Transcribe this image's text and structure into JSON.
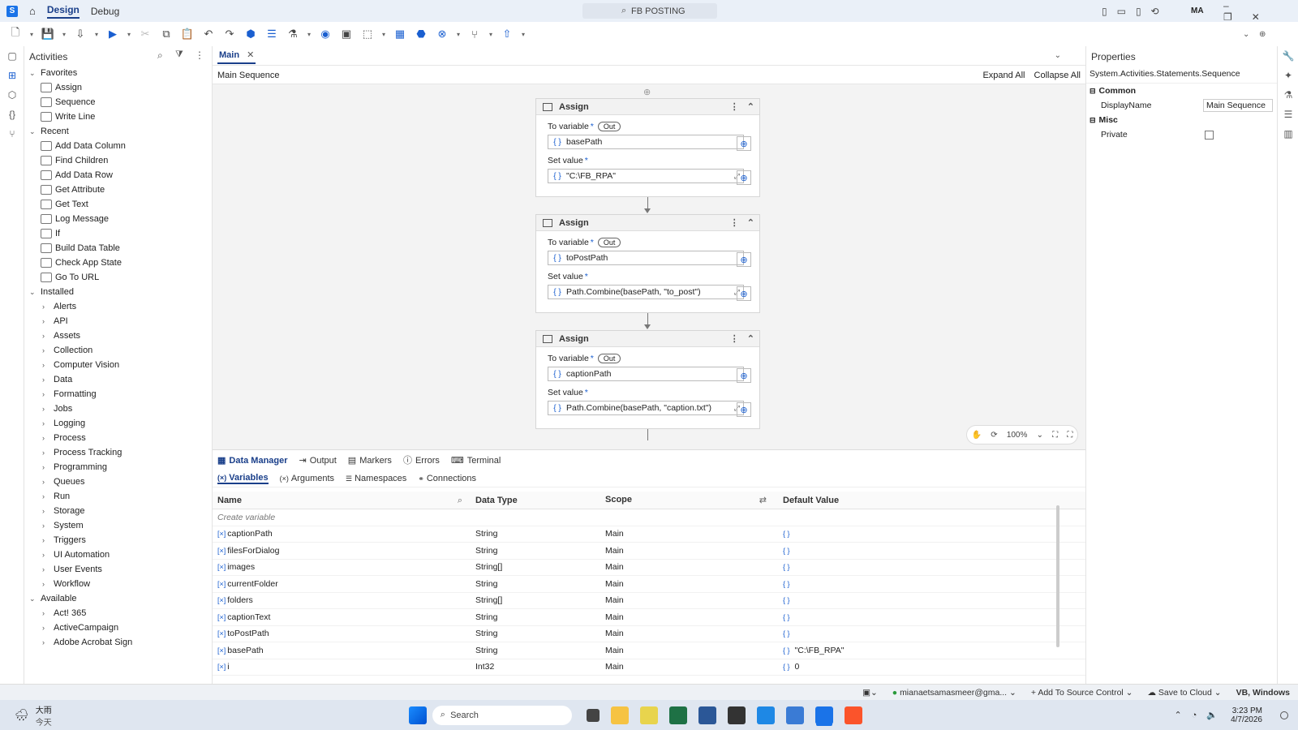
{
  "titlebar": {
    "tabs": [
      "Design",
      "Debug"
    ],
    "search": "FB POSTING",
    "user": "MA"
  },
  "activities": {
    "title": "Activities",
    "favorites_label": "Favorites",
    "favorites": [
      "Assign",
      "Sequence",
      "Write Line"
    ],
    "recent_label": "Recent",
    "recent": [
      "Add Data Column",
      "Find Children",
      "Add Data Row",
      "Get Attribute",
      "Get Text",
      "Log Message",
      "If",
      "Build Data Table",
      "Check App State",
      "Go To URL"
    ],
    "installed_label": "Installed",
    "installed": [
      "Alerts",
      "API",
      "Assets",
      "Collection",
      "Computer Vision",
      "Data",
      "Formatting",
      "Jobs",
      "Logging",
      "Process",
      "Process Tracking",
      "Programming",
      "Queues",
      "Run",
      "Storage",
      "System",
      "Triggers",
      "UI Automation",
      "User Events",
      "Workflow"
    ],
    "available_label": "Available",
    "available": [
      "Act! 365",
      "ActiveCampaign",
      "Adobe Acrobat Sign"
    ]
  },
  "designer": {
    "tab": "Main",
    "breadcrumb": "Main Sequence",
    "expand_all": "Expand All",
    "collapse_all": "Collapse All",
    "zoom": "100%",
    "assigns": [
      {
        "title": "Assign",
        "to_label": "To variable",
        "out": "Out",
        "to_value": "basePath",
        "set_label": "Set value",
        "set_value": "\"C:\\FB_RPA\""
      },
      {
        "title": "Assign",
        "to_label": "To variable",
        "out": "Out",
        "to_value": "toPostPath",
        "set_label": "Set value",
        "set_value": "Path.Combine(basePath, \"to_post\")"
      },
      {
        "title": "Assign",
        "to_label": "To variable",
        "out": "Out",
        "to_value": "captionPath",
        "set_label": "Set value",
        "set_value": "Path.Combine(basePath, \"caption.txt\")"
      }
    ]
  },
  "datapanel": {
    "tabs": [
      "Data Manager",
      "Output",
      "Markers",
      "Errors",
      "Terminal"
    ],
    "subtabs": [
      "Variables",
      "Arguments",
      "Namespaces",
      "Connections"
    ],
    "columns": [
      "Name",
      "Data Type",
      "Scope",
      "Default Value"
    ],
    "create_placeholder": "Create variable",
    "rows": [
      {
        "name": "captionPath",
        "type": "String",
        "scope": "Main",
        "default": ""
      },
      {
        "name": "filesForDialog",
        "type": "String",
        "scope": "Main",
        "default": ""
      },
      {
        "name": "images",
        "type": "String[]",
        "scope": "Main",
        "default": ""
      },
      {
        "name": "currentFolder",
        "type": "String",
        "scope": "Main",
        "default": ""
      },
      {
        "name": "folders",
        "type": "String[]",
        "scope": "Main",
        "default": ""
      },
      {
        "name": "captionText",
        "type": "String",
        "scope": "Main",
        "default": ""
      },
      {
        "name": "toPostPath",
        "type": "String",
        "scope": "Main",
        "default": ""
      },
      {
        "name": "basePath",
        "type": "String",
        "scope": "Main",
        "default": "\"C:\\FB_RPA\""
      },
      {
        "name": "i",
        "type": "Int32",
        "scope": "Main",
        "default": "0"
      }
    ]
  },
  "properties": {
    "title": "Properties",
    "type_name": "System.Activities.Statements.Sequence",
    "common": "Common",
    "display_name_label": "DisplayName",
    "display_name_value": "Main Sequence",
    "misc": "Misc",
    "private_label": "Private"
  },
  "statusbar": {
    "account": "mianaetsamasmeer@gma...",
    "source_control": "Add To Source Control",
    "save_cloud": "Save to Cloud",
    "lang": "VB, Windows"
  },
  "taskbar": {
    "weather": "大雨",
    "weather_sub": "今天",
    "search": "Search",
    "time": "3:23 PM",
    "date": "4/7/2026"
  },
  "colors": {
    "accent": "#1a3f8a",
    "link": "#1a5fd0"
  }
}
